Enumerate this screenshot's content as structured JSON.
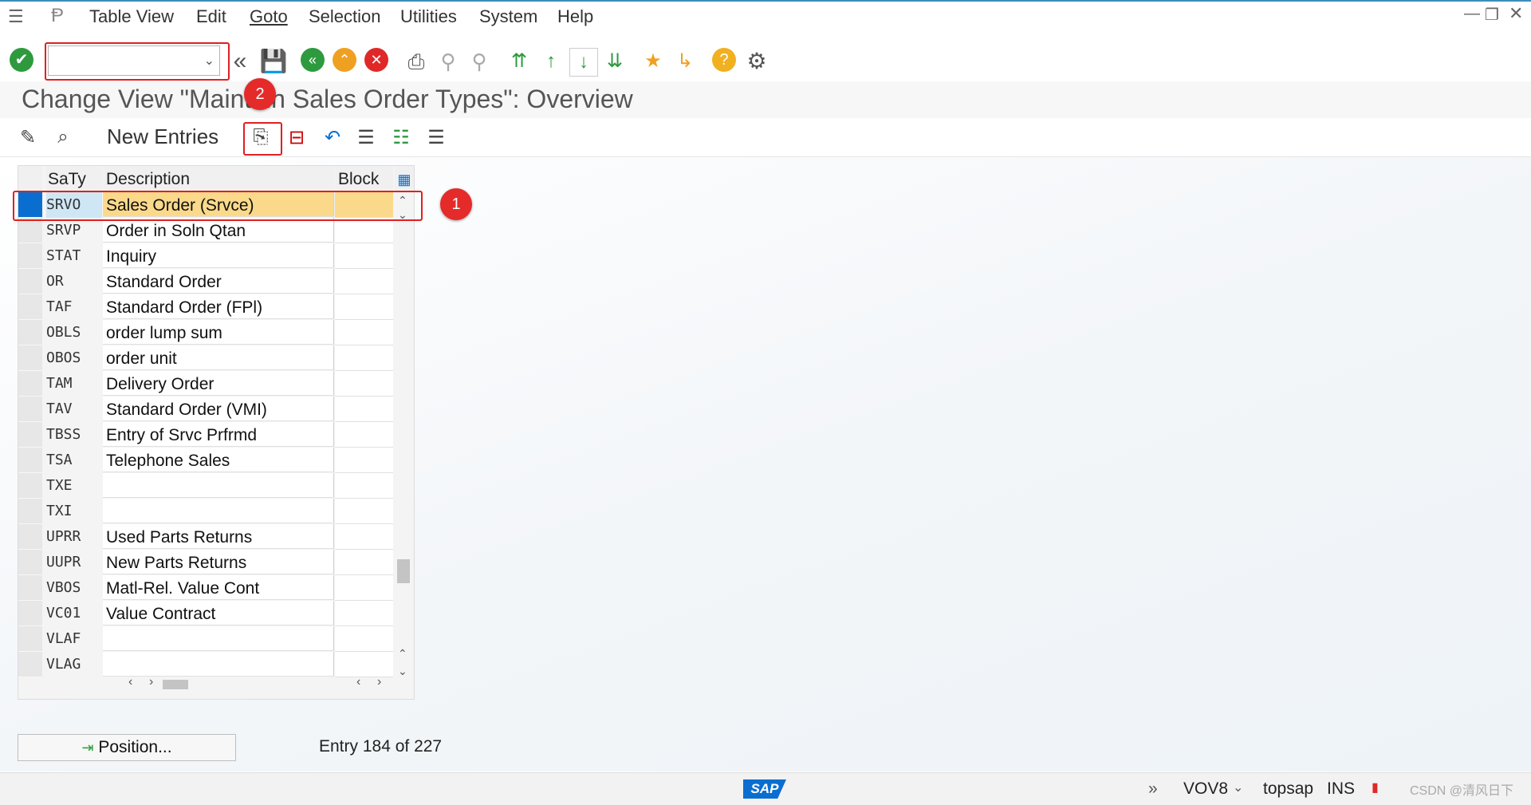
{
  "menu": {
    "items": [
      {
        "label": "Table View",
        "ul": false
      },
      {
        "label": "Edit",
        "ul": false
      },
      {
        "label": "Goto",
        "ul": true
      },
      {
        "label": "Selection",
        "ul": false
      },
      {
        "label": "Utilities",
        "ul": false
      },
      {
        "label": "System",
        "ul": false
      },
      {
        "label": "Help",
        "ul": false
      }
    ]
  },
  "toolbar": {
    "command_value": "",
    "icons": [
      "enter-check-icon",
      "back-double-chevron-icon",
      "save-icon",
      "back-icon",
      "exit-icon",
      "cancel-icon",
      "print-icon",
      "find-icon",
      "find-next-icon",
      "first-page-icon",
      "previous-page-icon",
      "next-page-icon",
      "last-page-icon",
      "create-session-icon",
      "shortcut-icon",
      "help-icon",
      "customize-layout-icon"
    ]
  },
  "title": "Change View \"Maintain Sales Order Types\": Overview",
  "app_toolbar": {
    "new_entries": "New Entries",
    "icons": [
      "display-change-icon",
      "details-icon",
      "copy-as-icon",
      "delete-icon",
      "undo-change-icon",
      "select-all-icon",
      "select-block-icon",
      "deselect-all-icon"
    ]
  },
  "table": {
    "headers": {
      "key": "SaTy",
      "desc": "Description",
      "block": "Block"
    },
    "rows": [
      {
        "key": "SRVO",
        "desc": "Sales Order (Srvce)",
        "selected": true
      },
      {
        "key": "SRVP",
        "desc": "Order in Soln Qtan"
      },
      {
        "key": "STAT",
        "desc": "Inquiry"
      },
      {
        "key": "OR",
        "desc": "Standard Order"
      },
      {
        "key": "TAF",
        "desc": "Standard Order (FPl)"
      },
      {
        "key": "OBLS",
        "desc": "order lump sum"
      },
      {
        "key": "OBOS",
        "desc": "order unit"
      },
      {
        "key": "TAM",
        "desc": "Delivery Order"
      },
      {
        "key": "TAV",
        "desc": "Standard Order (VMI)"
      },
      {
        "key": "TBSS",
        "desc": "Entry of Srvc Prfrmd"
      },
      {
        "key": "TSA",
        "desc": "Telephone Sales"
      },
      {
        "key": "TXE",
        "desc": ""
      },
      {
        "key": "TXI",
        "desc": ""
      },
      {
        "key": "UPRR",
        "desc": "Used Parts Returns"
      },
      {
        "key": "UUPR",
        "desc": "New Parts Returns"
      },
      {
        "key": "VBOS",
        "desc": "Matl-Rel. Value Cont"
      },
      {
        "key": "VC01",
        "desc": "Value Contract"
      },
      {
        "key": "VLAF",
        "desc": ""
      },
      {
        "key": "VLAG",
        "desc": ""
      }
    ]
  },
  "annotations": {
    "badge1": "1",
    "badge2": "2"
  },
  "position_button": "Position...",
  "entry_info": "Entry 184 of 227",
  "status": {
    "logo": "SAP",
    "transaction": "VOV8",
    "server": "topsap",
    "mode": "INS",
    "watermark": "CSDN @清风日下"
  },
  "colors": {
    "selected_row": "#fbd98b",
    "accent": "#0a6ed1",
    "annotation": "#e52a2a"
  }
}
